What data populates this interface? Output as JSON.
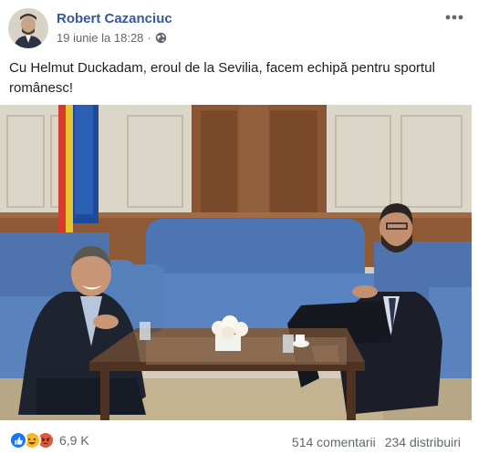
{
  "post": {
    "author": "Robert Cazanciuc",
    "date": "19 iunie la 18:28",
    "privacy_icon": "globe-icon",
    "text": "Cu Helmut Duckadam, eroul de la Sevilia, facem echipă pentru sportul românesc!"
  },
  "footer": {
    "reactions": [
      "like-icon",
      "haha-icon",
      "angry-icon"
    ],
    "reaction_count": "6,9 K",
    "comments": "514 comentarii",
    "shares": "234 distribuiri"
  },
  "colors": {
    "author_link": "#385898",
    "secondary_text": "#606770",
    "like": "#1877f2",
    "haha": "#f7b928",
    "angry": "#e4553a"
  }
}
